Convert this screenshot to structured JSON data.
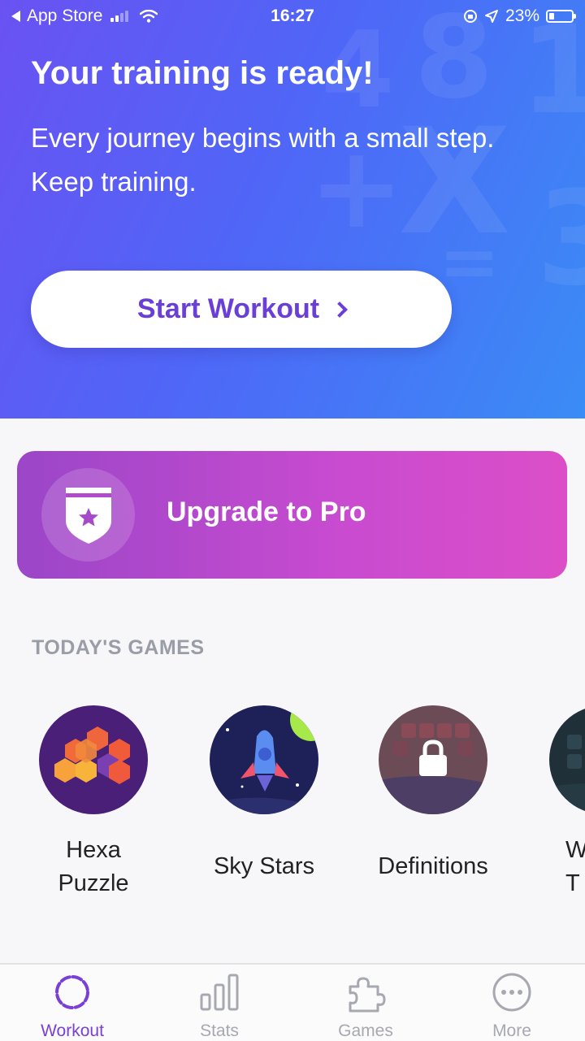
{
  "status_bar": {
    "back_label": "App Store",
    "time": "16:27",
    "battery": "23%",
    "battery_level": 0.23
  },
  "hero": {
    "title": "Your training is ready!",
    "subtitle": "Every journey begins with a small step. Keep training.",
    "cta_label": "Start Workout",
    "decor_glyphs": [
      "4",
      "8",
      "1",
      "+",
      "X",
      "=",
      "3"
    ]
  },
  "upgrade": {
    "label": "Upgrade to Pro"
  },
  "games": {
    "section_title": "TODAY'S GAMES",
    "items": [
      {
        "label": "Hexa Puzzle",
        "icon": "hexagon-puzzle-icon",
        "locked": false
      },
      {
        "label": "Sky Stars",
        "icon": "rocket-icon",
        "locked": false
      },
      {
        "label": "Definitions",
        "icon": "lock-icon",
        "locked": true
      },
      {
        "label": "W T",
        "icon": "partial-game-icon",
        "locked": false
      }
    ]
  },
  "tabbar": {
    "tabs": [
      {
        "label": "Workout",
        "icon": "workout-ring-icon",
        "active": true
      },
      {
        "label": "Stats",
        "icon": "bar-chart-icon",
        "active": false
      },
      {
        "label": "Games",
        "icon": "puzzle-piece-icon",
        "active": false
      },
      {
        "label": "More",
        "icon": "more-dots-icon",
        "active": false
      }
    ]
  },
  "colors": {
    "accent": "#7a3fd6",
    "hero_start": "#6a52f2",
    "hero_end": "#3a8cf6",
    "upgrade_start": "#9b46c8",
    "upgrade_end": "#dc4ec8",
    "tab_inactive": "#a7a8b0"
  }
}
